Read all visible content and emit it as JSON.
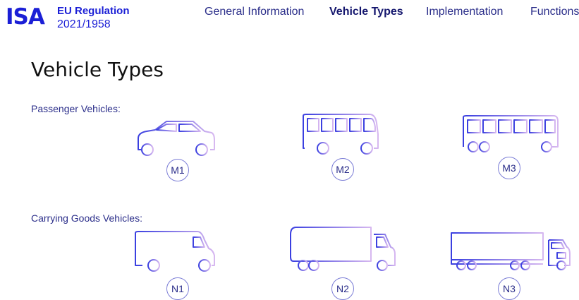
{
  "header": {
    "logo": "ISA",
    "regulation_title": "EU Regulation",
    "regulation_number": "2021/1958",
    "nav": [
      {
        "label": "General Information",
        "active": false
      },
      {
        "label": "Vehicle Types",
        "active": true
      },
      {
        "label": "Implementation",
        "active": false
      },
      {
        "label": "Functions",
        "active": false
      }
    ]
  },
  "page": {
    "title": "Vehicle Types",
    "sections": [
      {
        "label": "Passenger Vehicles:",
        "vehicles": [
          {
            "code": "M1",
            "icon": "car-icon"
          },
          {
            "code": "M2",
            "icon": "minibus-icon"
          },
          {
            "code": "M3",
            "icon": "bus-icon"
          }
        ]
      },
      {
        "label": "Carrying Goods Vehicles:",
        "vehicles": [
          {
            "code": "N1",
            "icon": "van-icon"
          },
          {
            "code": "N2",
            "icon": "truck-icon"
          },
          {
            "code": "N3",
            "icon": "semi-truck-icon"
          }
        ]
      }
    ]
  },
  "colors": {
    "brand": "#1b1fd6",
    "gradient_start": "#3a3fe0",
    "gradient_end": "#d7b8f0",
    "badge_border": "#7b7dd6"
  }
}
